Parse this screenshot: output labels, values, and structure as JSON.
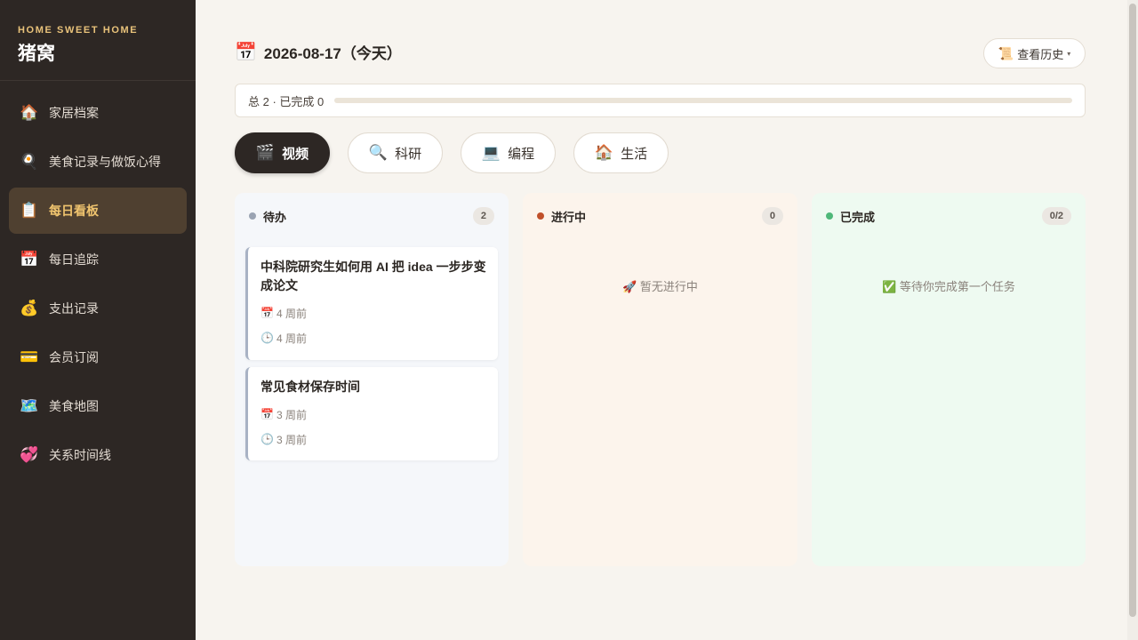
{
  "brand": {
    "subtitle": "HOME SWEET HOME",
    "title": "猪窝"
  },
  "sidebar": {
    "items": [
      {
        "icon": "🏠",
        "icon_name": "house-icon",
        "label": "家居档案",
        "active": false
      },
      {
        "icon": "🍳",
        "icon_name": "frying-pan-icon",
        "label": "美食记录与做饭心得",
        "active": false
      },
      {
        "icon": "📋",
        "icon_name": "clipboard-icon",
        "label": "每日看板",
        "active": true
      },
      {
        "icon": "📅",
        "icon_name": "calendar-icon",
        "label": "每日追踪",
        "active": false
      },
      {
        "icon": "💰",
        "icon_name": "money-bag-icon",
        "label": "支出记录",
        "active": false
      },
      {
        "icon": "💳",
        "icon_name": "credit-card-icon",
        "label": "会员订阅",
        "active": false
      },
      {
        "icon": "🗺️",
        "icon_name": "map-icon",
        "label": "美食地图",
        "active": false
      },
      {
        "icon": "💞",
        "icon_name": "hearts-icon",
        "label": "关系时间线",
        "active": false
      }
    ]
  },
  "header": {
    "icon": "📅",
    "title": "2026-08-17（今天）"
  },
  "history": {
    "icon": "📜",
    "label": "查看历史",
    "caret": "▾"
  },
  "summary": {
    "text": "总 2 · 已完成 0",
    "progress": 0
  },
  "tabs": [
    {
      "icon": "🎬",
      "icon_name": "clapper-icon",
      "label": "视频",
      "active": true
    },
    {
      "icon": "🔍",
      "icon_name": "search-icon",
      "label": "科研",
      "active": false
    },
    {
      "icon": "💻",
      "icon_name": "laptop-icon",
      "label": "编程",
      "active": false
    },
    {
      "icon": "🏠",
      "icon_name": "house-icon",
      "label": "生活",
      "active": false
    }
  ],
  "columns": {
    "todo": {
      "title": "待办",
      "count": "2",
      "dot_color": "#9aa3b2"
    },
    "doing": {
      "title": "进行中",
      "count": "0",
      "dot_color": "#c0502a",
      "empty": "🚀 暂无进行中"
    },
    "done": {
      "title": "已完成",
      "count": "0/2",
      "dot_color": "#4fb879",
      "empty": "✅ 等待你完成第一个任务"
    }
  },
  "cards": [
    {
      "title": "中科院研究生如何用 AI 把 idea 一步步变成论文",
      "created_icon": "📅",
      "created": "4 周前",
      "updated_icon": "🕒",
      "updated": "4 周前"
    },
    {
      "title": "常见食材保存时间",
      "created_icon": "📅",
      "created": "3 周前",
      "updated_icon": "🕒",
      "updated": "3 周前"
    }
  ]
}
